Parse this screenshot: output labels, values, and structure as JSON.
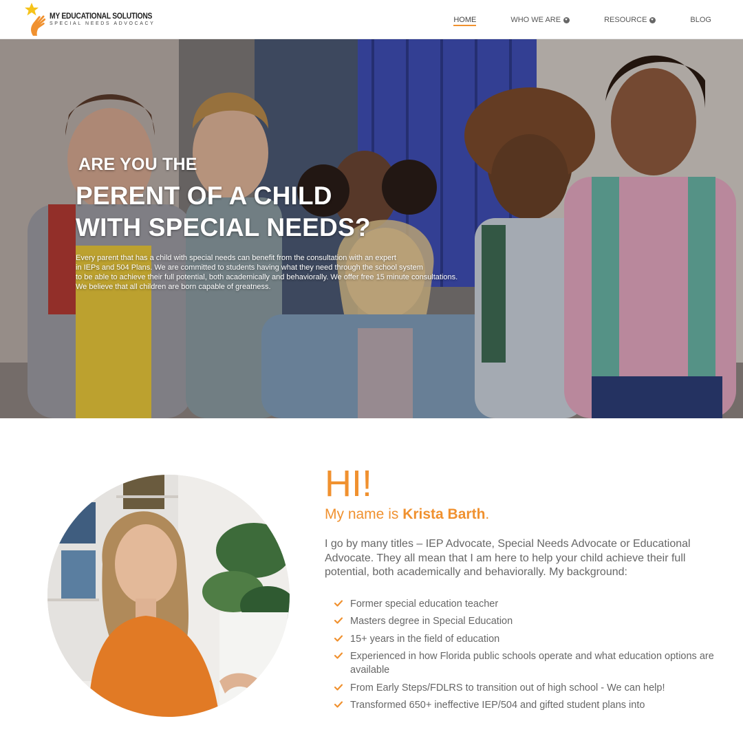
{
  "brand": {
    "title": "MY EDUCATIONAL SOLUTIONS",
    "subtitle": "SPECIAL NEEDS ADVOCACY",
    "accent": "#f0912f",
    "icon": "hand-star-logo"
  },
  "nav": {
    "items": [
      {
        "label": "HOME",
        "active": true,
        "dropdown": false
      },
      {
        "label": "WHO WE ARE",
        "active": false,
        "dropdown": true
      },
      {
        "label": "RESOURCE",
        "active": false,
        "dropdown": true
      },
      {
        "label": "BLOG",
        "active": false,
        "dropdown": false
      }
    ]
  },
  "hero": {
    "kicker": "ARE YOU THE",
    "title_line1": "PERENT OF A CHILD",
    "title_line2": "WITH SPECIAL NEEDS?",
    "body_lines": [
      "Every parent that has a child with special needs can benefit from the consultation with an expert",
      "in IEPs and 504 Plans. We are committed to students having what they need through the school system",
      "to be able to achieve their full potential, both academically and behaviorally. We offer free 15 minute consultations.",
      "We believe that all children are born capable of greatness."
    ]
  },
  "about": {
    "greeting": "HI!",
    "name_prefix": "My name is ",
    "name": "Krista Barth",
    "name_suffix": ".",
    "intro": "I go by many titles – IEP Advocate, Special Needs Advocate or Educational Advocate.  They all mean that I am here to help your child achieve their full potential, both academically and behaviorally.  My background:",
    "bullets": [
      "Former special education teacher",
      "Masters degree in Special Education",
      "15+ years in the field of education",
      "Experienced in how Florida public schools operate and what education options are available",
      "From Early Steps/FDLRS to transition out of high school - We can help!",
      "Transformed 650+ ineffective IEP/504 and gifted student plans into"
    ],
    "bullet_icon": "check-icon"
  }
}
